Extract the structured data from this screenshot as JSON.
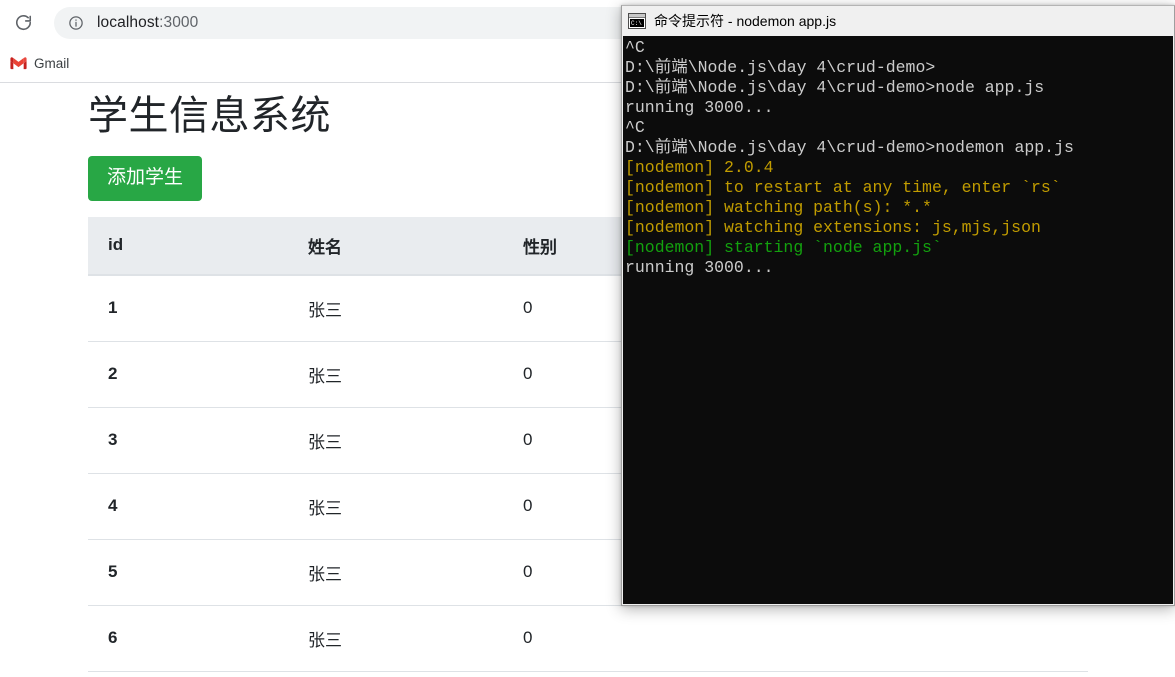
{
  "browser": {
    "reload_icon": "reload-icon",
    "site_info_icon": "info-circle-icon",
    "url_host": "localhost",
    "url_port": ":3000",
    "url_full": "localhost:3000",
    "bookmarks": [
      {
        "label": "Gmail",
        "icon": "gmail-icon"
      }
    ]
  },
  "page": {
    "title": "学生信息系统",
    "add_button_label": "添加学生",
    "table": {
      "columns": [
        "id",
        "姓名",
        "性别",
        ""
      ],
      "rows": [
        {
          "id": "1",
          "name": "张三",
          "gender": "0",
          "extra": ""
        },
        {
          "id": "2",
          "name": "张三",
          "gender": "0",
          "extra": ""
        },
        {
          "id": "3",
          "name": "张三",
          "gender": "0",
          "extra": ""
        },
        {
          "id": "4",
          "name": "张三",
          "gender": "0",
          "extra": ""
        },
        {
          "id": "5",
          "name": "张三",
          "gender": "0",
          "extra": ""
        },
        {
          "id": "6",
          "name": "张三",
          "gender": "0",
          "extra": ""
        }
      ]
    }
  },
  "terminal": {
    "icon": "cmd-console-icon",
    "icon_glyph": "C:\\",
    "title": "命令提示符 - nodemon app.js",
    "lines": [
      {
        "text": "^C",
        "color": "default"
      },
      {
        "text": "D:\\前端\\Node.js\\day 4\\crud-demo>",
        "color": "default"
      },
      {
        "text": "",
        "color": "default"
      },
      {
        "text": "D:\\前端\\Node.js\\day 4\\crud-demo>node app.js",
        "color": "default"
      },
      {
        "text": "running 3000...",
        "color": "default"
      },
      {
        "text": "^C",
        "color": "default"
      },
      {
        "text": "D:\\前端\\Node.js\\day 4\\crud-demo>nodemon app.js",
        "color": "default"
      },
      {
        "text": "[nodemon] 2.0.4",
        "color": "yellow"
      },
      {
        "text": "[nodemon] to restart at any time, enter `rs`",
        "color": "yellow"
      },
      {
        "text": "[nodemon] watching path(s): *.*",
        "color": "yellow"
      },
      {
        "text": "[nodemon] watching extensions: js,mjs,json",
        "color": "yellow"
      },
      {
        "text": "[nodemon] starting `node app.js`",
        "color": "green"
      },
      {
        "text": "running 3000...",
        "color": "default"
      }
    ]
  },
  "colors": {
    "accent_green": "#28a745",
    "table_header_bg": "#e9ecef",
    "terminal_bg": "#0c0c0c",
    "terminal_yellow": "#c19c00",
    "terminal_green": "#13a10e",
    "omnibox_bg": "#f1f3f4"
  }
}
